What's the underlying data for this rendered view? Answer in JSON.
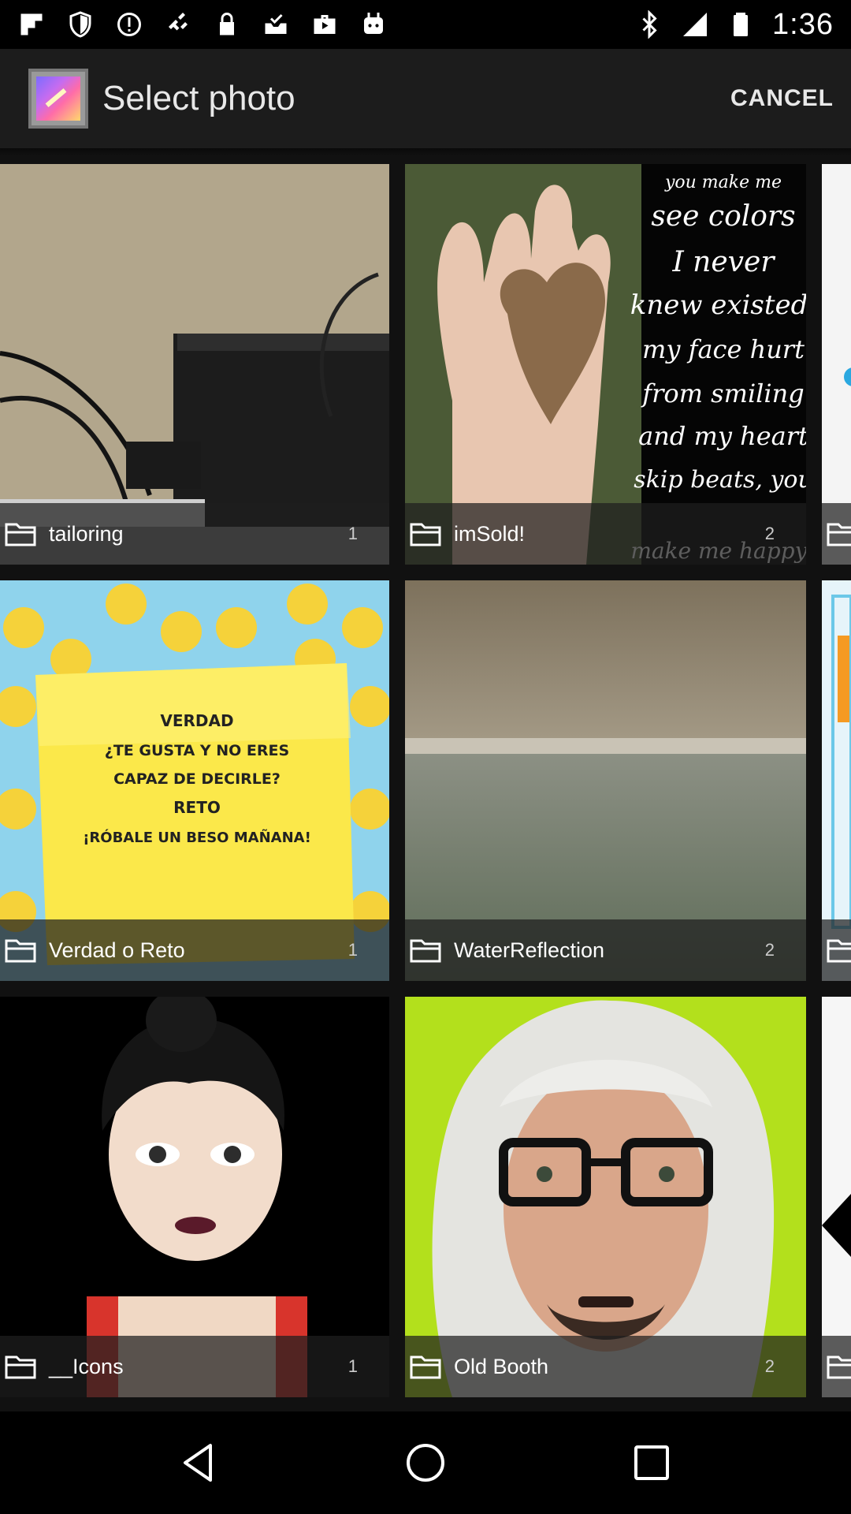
{
  "status_bar": {
    "time": "1:36",
    "icons": [
      "flipboard-icon",
      "shield-icon",
      "alert-icon",
      "fake-gps-icon",
      "lock-icon",
      "checkbox-inbox-icon",
      "briefcase-icon",
      "android-icon",
      "bluetooth-icon",
      "cellular-signal-icon",
      "battery-icon"
    ]
  },
  "app_bar": {
    "title": "Select photo",
    "cancel_label": "CANCEL",
    "icon": "gallery-icon"
  },
  "albums": [
    {
      "name": "tailoring",
      "count": "1"
    },
    {
      "name": "imSold!",
      "count": "2"
    },
    {
      "name": "",
      "count": ""
    },
    {
      "name": "Verdad o Reto",
      "count": "1"
    },
    {
      "name": "WaterReflection",
      "count": "2"
    },
    {
      "name": "",
      "count": ""
    },
    {
      "name": "__Icons",
      "count": "1"
    },
    {
      "name": "Old Booth",
      "count": "2"
    },
    {
      "name": "",
      "count": ""
    }
  ],
  "thumbnail_texts": {
    "imsold_poem": "you make me see colors I never knew existed, my face hurt from smiling and my heart skip beats, you make me happy!",
    "sticky_note": [
      "VERDAD",
      "¿TE GUSTA Y NO ERES",
      "CAPAZ DE DECIRLE?",
      "RETO",
      "¡RÓBALE UN BESO MAÑANA!"
    ]
  },
  "nav_bar": {
    "icons": [
      "back-icon",
      "home-icon",
      "recents-icon"
    ]
  },
  "colors": {
    "app_bar_bg": "#1c1c1c",
    "caption_bg": "#1e1e1e",
    "grid_bg": "#111111",
    "text": "#ffffff"
  }
}
